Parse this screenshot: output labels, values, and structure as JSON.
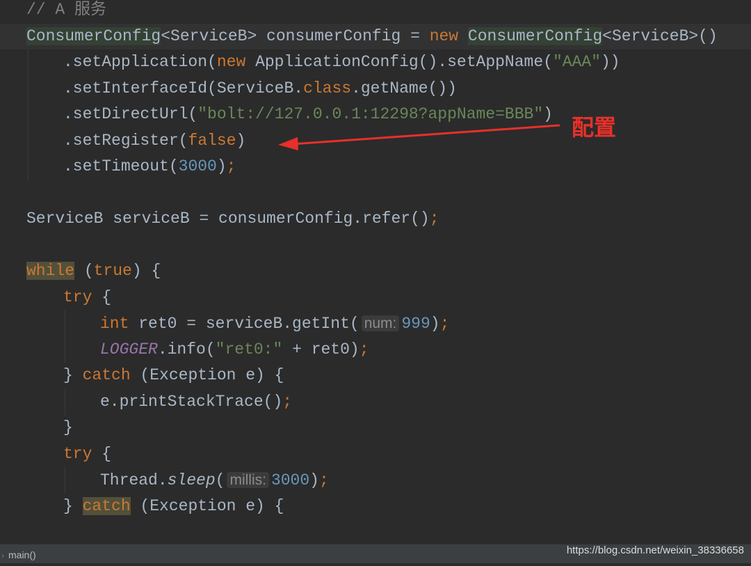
{
  "editor": {
    "lines": [
      {
        "id": "comment-a-service",
        "indent": 0,
        "tokens": [
          {
            "t": "// A 服务",
            "c": "comment"
          }
        ]
      },
      {
        "id": "consumer-config-decl",
        "indent": 0,
        "current": true,
        "tokens": [
          {
            "t": "ConsumerConfig",
            "c": "hl"
          },
          {
            "t": "<ServiceB> consumerConfig = ",
            "c": "text"
          },
          {
            "t": "new ",
            "c": "kw"
          },
          {
            "t": "ConsumerConfig",
            "c": "hl"
          },
          {
            "t": "<ServiceB>()",
            "c": "text"
          }
        ]
      },
      {
        "id": "set-application",
        "indent": 1,
        "tokens": [
          {
            "t": ".setApplication(",
            "c": "text"
          },
          {
            "t": "new ",
            "c": "kw"
          },
          {
            "t": "ApplicationConfig().setAppName(",
            "c": "text"
          },
          {
            "t": "\"AAA\"",
            "c": "str"
          },
          {
            "t": "))",
            "c": "text"
          }
        ]
      },
      {
        "id": "set-interface-id",
        "indent": 1,
        "tokens": [
          {
            "t": ".setInterfaceId(ServiceB.",
            "c": "text"
          },
          {
            "t": "class",
            "c": "kw"
          },
          {
            "t": ".getName())",
            "c": "text"
          }
        ]
      },
      {
        "id": "set-direct-url",
        "indent": 1,
        "tokens": [
          {
            "t": ".setDirectUrl(",
            "c": "text"
          },
          {
            "t": "\"bolt://127.0.0.1:12298?appName=BBB\"",
            "c": "str"
          },
          {
            "t": ")",
            "c": "text"
          }
        ]
      },
      {
        "id": "set-register",
        "indent": 1,
        "tokens": [
          {
            "t": ".setRegister(",
            "c": "text"
          },
          {
            "t": "false",
            "c": "kw"
          },
          {
            "t": ")",
            "c": "text"
          }
        ]
      },
      {
        "id": "set-timeout",
        "indent": 1,
        "tokens": [
          {
            "t": ".setTimeout(",
            "c": "text"
          },
          {
            "t": "3000",
            "c": "num"
          },
          {
            "t": ")",
            "c": "text"
          },
          {
            "t": ";",
            "c": "kw"
          }
        ]
      },
      {
        "id": "blank-1",
        "indent": 0,
        "tokens": []
      },
      {
        "id": "refer-call",
        "indent": 0,
        "tokens": [
          {
            "t": "ServiceB serviceB = consumerConfig.refer()",
            "c": "text"
          },
          {
            "t": ";",
            "c": "kw"
          }
        ]
      },
      {
        "id": "blank-2",
        "indent": 0,
        "tokens": []
      },
      {
        "id": "while-loop",
        "indent": 0,
        "tokens": [
          {
            "t": "while",
            "c": "hlkw"
          },
          {
            "t": " (",
            "c": "text"
          },
          {
            "t": "true",
            "c": "kw"
          },
          {
            "t": ") {",
            "c": "text"
          }
        ]
      },
      {
        "id": "try-1",
        "indent": 1,
        "tokens": [
          {
            "t": "try",
            "c": "kw"
          },
          {
            "t": " {",
            "c": "text"
          }
        ]
      },
      {
        "id": "get-int-call",
        "indent": 2,
        "tokens": [
          {
            "t": "int",
            "c": "kw"
          },
          {
            "t": " ret0 = serviceB.getInt(",
            "c": "text"
          },
          {
            "t": "num:",
            "c": "hint"
          },
          {
            "t": "999",
            "c": "num"
          },
          {
            "t": ")",
            "c": "text"
          },
          {
            "t": ";",
            "c": "kw"
          }
        ]
      },
      {
        "id": "logger-info",
        "indent": 2,
        "tokens": [
          {
            "t": "LOGGER",
            "c": "const"
          },
          {
            "t": ".info(",
            "c": "text"
          },
          {
            "t": "\"ret0:\"",
            "c": "str"
          },
          {
            "t": " + ret0)",
            "c": "text"
          },
          {
            "t": ";",
            "c": "kw"
          }
        ]
      },
      {
        "id": "catch-1",
        "indent": 1,
        "tokens": [
          {
            "t": "} ",
            "c": "text"
          },
          {
            "t": "catch",
            "c": "kw"
          },
          {
            "t": " (Exception e) {",
            "c": "text"
          }
        ]
      },
      {
        "id": "print-stack-trace",
        "indent": 2,
        "tokens": [
          {
            "t": "e.printStackTrace()",
            "c": "text"
          },
          {
            "t": ";",
            "c": "kw"
          }
        ]
      },
      {
        "id": "close-brace",
        "indent": 1,
        "tokens": [
          {
            "t": "}",
            "c": "text"
          }
        ]
      },
      {
        "id": "try-2",
        "indent": 1,
        "tokens": [
          {
            "t": "try",
            "c": "kw"
          },
          {
            "t": " {",
            "c": "text"
          }
        ]
      },
      {
        "id": "thread-sleep",
        "indent": 2,
        "tokens": [
          {
            "t": "Thread.",
            "c": "text"
          },
          {
            "t": "sleep",
            "c": "static"
          },
          {
            "t": "(",
            "c": "text"
          },
          {
            "t": "millis:",
            "c": "hint"
          },
          {
            "t": "3000",
            "c": "num"
          },
          {
            "t": ")",
            "c": "text"
          },
          {
            "t": ";",
            "c": "kw"
          }
        ]
      },
      {
        "id": "catch-2",
        "indent": 1,
        "tokens": [
          {
            "t": "} ",
            "c": "text"
          },
          {
            "t": "catch",
            "c": "hlkw"
          },
          {
            "t": " (Exception e) {",
            "c": "text"
          }
        ]
      }
    ]
  },
  "annotation": {
    "label": "配置",
    "color": "#e8302a"
  },
  "status_bar": {
    "breadcrumb": "main()",
    "chevron_icon": "chevron-right-icon"
  },
  "watermark": "https://blog.csdn.net/weixin_38336658"
}
